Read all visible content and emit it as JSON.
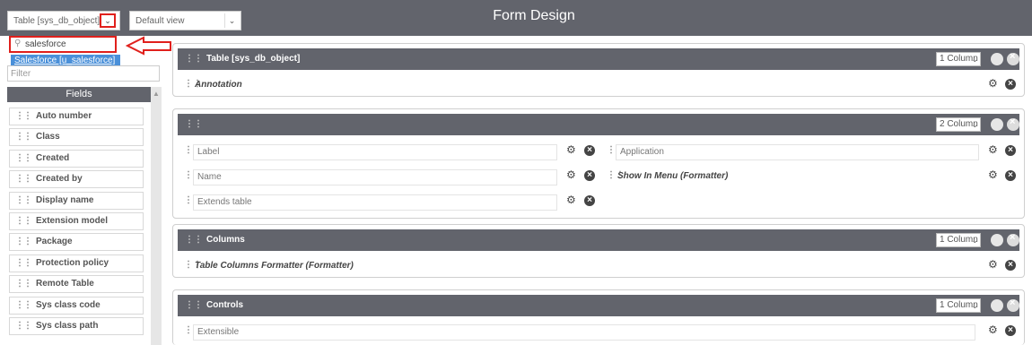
{
  "header": {
    "table_select": "Table [sys_db_object]",
    "view_select": "Default view",
    "title": "Form Design"
  },
  "search": {
    "value": "salesforce",
    "suggestion": "Salesforce [u_salesforce]"
  },
  "filter": {
    "placeholder": "Filter"
  },
  "fields": {
    "header": "Fields",
    "items": [
      "Auto number",
      "Class",
      "Created",
      "Created by",
      "Display name",
      "Extension model",
      "Package",
      "Protection policy",
      "Remote Table",
      "Sys class code",
      "Sys class path"
    ]
  },
  "sections": [
    {
      "title": "Table [sys_db_object]",
      "columns": "1 Column",
      "rows": [
        [
          "Annotation"
        ]
      ]
    },
    {
      "title": "",
      "columns": "2 Column",
      "left": [
        "Label",
        "Name",
        "Extends table"
      ],
      "right": [
        "Application",
        "Show In Menu (Formatter)"
      ]
    },
    {
      "title": "Columns",
      "columns": "1 Column",
      "rows": [
        [
          "Table Columns Formatter (Formatter)"
        ]
      ]
    },
    {
      "title": "Controls",
      "columns": "1 Column",
      "rows": [
        [
          "Extensible"
        ]
      ]
    }
  ]
}
